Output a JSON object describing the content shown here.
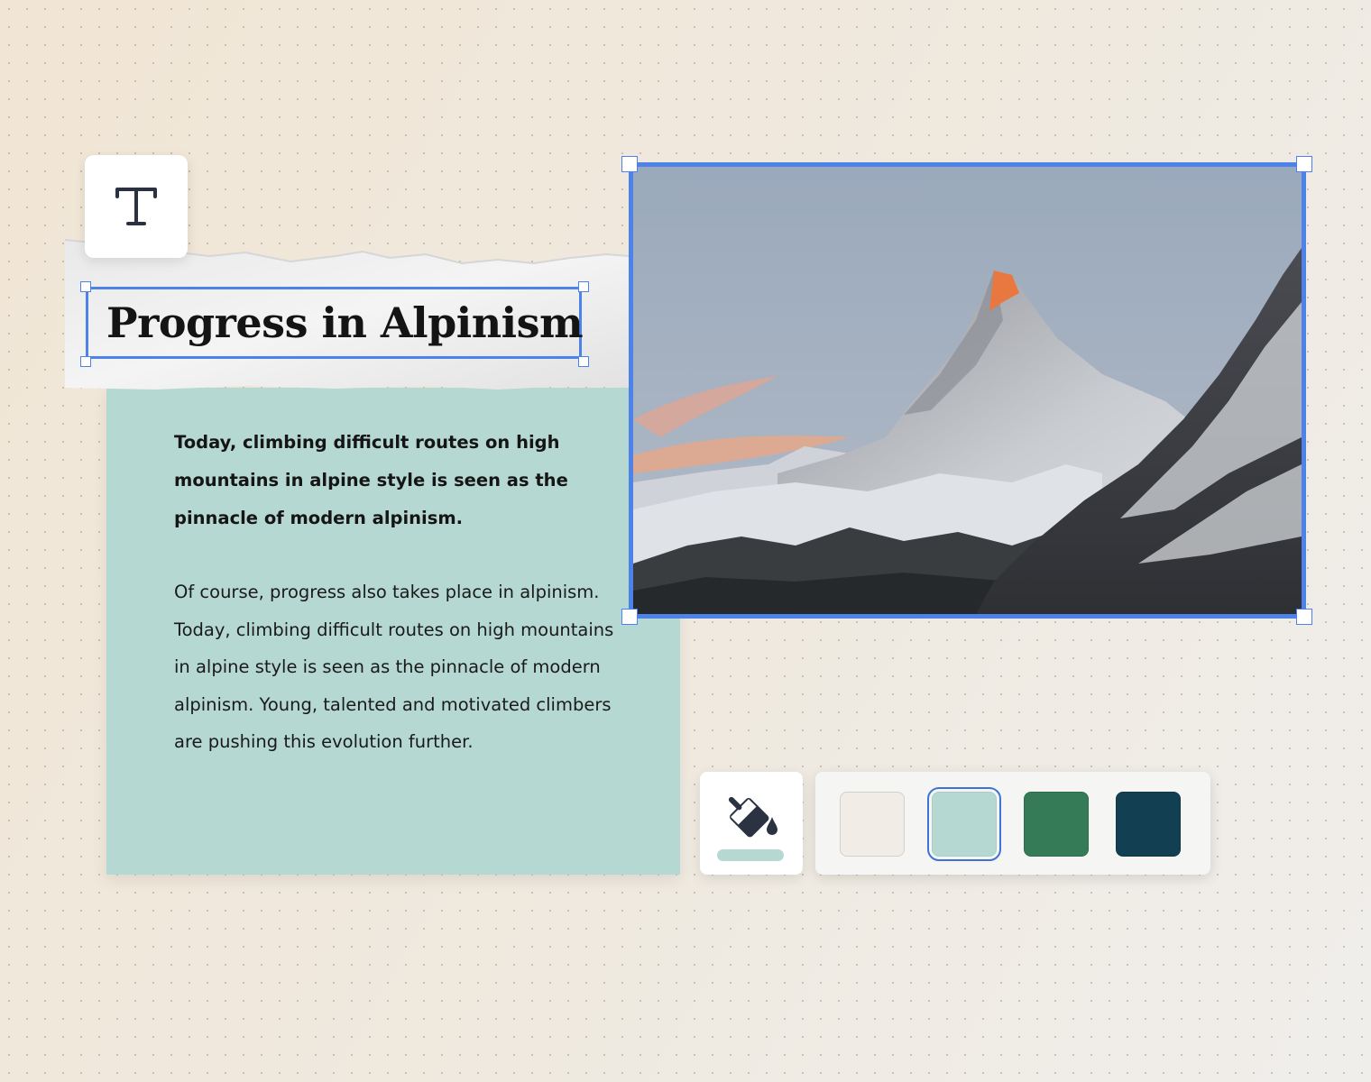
{
  "toolbar": {
    "text_tool_icon": "text-tool-icon",
    "fill_tool_icon": "paint-bucket-icon"
  },
  "document": {
    "title": "Progress in Alpinism",
    "lead": "Today, climbing difficult routes on high mountains in alpine style is seen as the pinnacle of modern alpinism.",
    "body": "Of course, progress also takes place in alpinism. Today, climbing difficult routes on high mountains in alpine style is seen as the pinnacle of modern alpinism. Young, talented and motivated climbers are pushing this evolution further."
  },
  "image": {
    "subject": "mountain-photo"
  },
  "palette": {
    "selected_index": 1,
    "swatches": [
      "#f1ece6",
      "#b5d8d2",
      "#357b58",
      "#133f52"
    ]
  },
  "colors": {
    "selection": "#4d82e8",
    "card": "#b5d8d2",
    "fill_indicator": "#b5d8d2"
  }
}
